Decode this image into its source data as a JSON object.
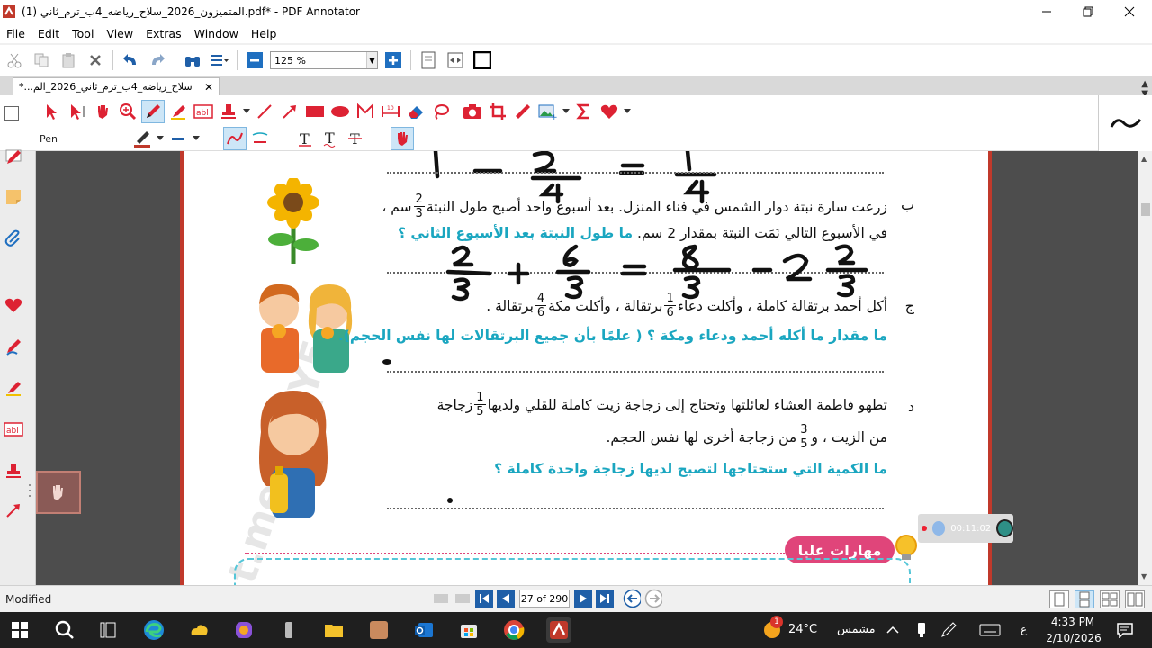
{
  "window": {
    "title": "المتميزون_2026_سلاح_رياضه_4ب_ترم_ثاني (1).pdf* - PDF Annotator"
  },
  "menu": [
    "File",
    "Edit",
    "Tool",
    "View",
    "Extras",
    "Window",
    "Help"
  ],
  "toolbar": {
    "zoom_value": "125 %"
  },
  "tab": {
    "label": "*...سلاح_رياضه_4ب_ترم_ثاني_2026_الم",
    "close": "✕"
  },
  "annotation_bar": {
    "current_tool": "Pen"
  },
  "document": {
    "watermark": "t.me/G5_Y5",
    "q_b": {
      "letter": "ب",
      "line1a": "زرعت سارة نبتة دوار الشمس في فناء المنزل. بعد أسبوع واحد أصبح طول النبتة",
      "line1_frac": {
        "num": "2",
        "den": "3"
      },
      "line1b": "سم ،",
      "line2": "في الأسبوع التالي نَمَت النبتة بمقدار 2 سم.",
      "line2_question": "ما طول النبتة بعد الأسبوع الثاني ؟"
    },
    "q_c": {
      "letter": "ج",
      "line1a": "أكل أحمد برتقالة كاملة ، وأكلت دعاء",
      "frac1": {
        "num": "1",
        "den": "6"
      },
      "line1b": "برتقالة ، وأكلت مكة",
      "frac2": {
        "num": "4",
        "den": "6"
      },
      "line1c": "برتقالة .",
      "question": "ما مقدار ما أكله أحمد ودعاء ومكة ؟ ( علمًا بأن جميع البرتقالات لها نفس الحجم)."
    },
    "q_d": {
      "letter": "د",
      "line1a": "تطهو فاطمة العشاء لعائلتها وتحتاج إلى زجاجة زيت كاملة للقلي ولديها",
      "frac1": {
        "num": "1",
        "den": "5"
      },
      "line1b": "زجاجة",
      "line2a": "من الزيت ، و",
      "frac2": {
        "num": "3",
        "den": "5"
      },
      "line2b": "من زجاجة أخرى لها نفس الحجم.",
      "question": "ما الكمية التي ستحتاجها لتصبح لديها زجاجة واحدة كاملة ؟"
    },
    "skills_badge": "مهارات عليا",
    "handwriting": {
      "top": "1 - 2/4 = 1/4",
      "middle": "2/3 + 6/3 = 8/3 = 2 2/3"
    }
  },
  "recorder": {
    "time": "00:11:02"
  },
  "status": {
    "state": "Modified",
    "page": "27 of 290"
  },
  "taskbar": {
    "weather_temp": "24°C",
    "weather_desc": "مشمس",
    "weather_badge": "1",
    "lang": "ع",
    "time": "4:33 PM",
    "date": "2/10/2026"
  },
  "colors": {
    "accent_red": "#c0392b",
    "cyan_text": "#1aa6c0",
    "tool_blue": "#1f5fa8"
  }
}
